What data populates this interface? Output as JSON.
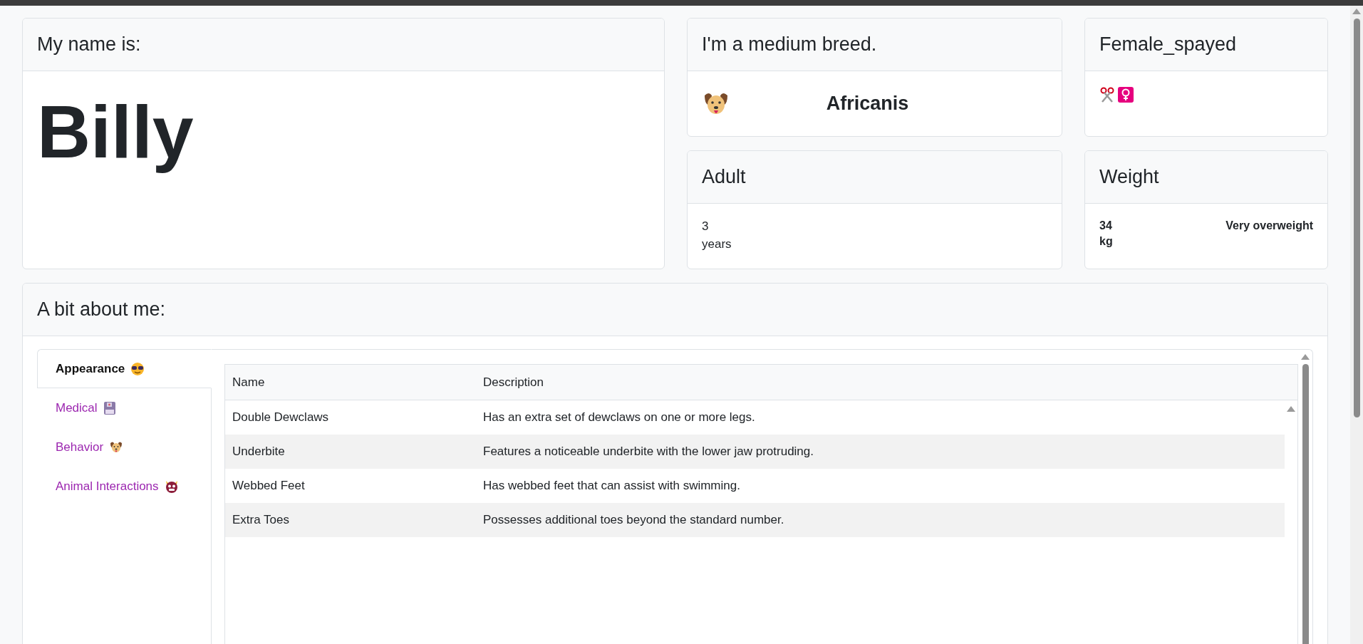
{
  "name_card": {
    "title": "My name is:",
    "name": "Billy"
  },
  "breed_card": {
    "title": "I'm a medium breed.",
    "breed": "Africanis"
  },
  "sex_card": {
    "title": "Female_spayed"
  },
  "age_card": {
    "title": "Adult",
    "value": "3",
    "unit": "years"
  },
  "weight_card": {
    "title": "Weight",
    "value": "34",
    "unit": "kg",
    "status": "Very overweight"
  },
  "about": {
    "title": "A bit about me:",
    "tabs": [
      {
        "label": "Appearance",
        "selected": true
      },
      {
        "label": "Medical",
        "selected": false
      },
      {
        "label": "Behavior",
        "selected": false
      },
      {
        "label": "Animal Interactions",
        "selected": false
      }
    ],
    "table": {
      "columns": [
        "Name",
        "Description"
      ],
      "rows": [
        [
          "Double Dewclaws",
          "Has an extra set of dewclaws on one or more legs."
        ],
        [
          "Underbite",
          "Features a noticeable underbite with the lower jaw protruding."
        ],
        [
          "Webbed Feet",
          "Has webbed feet that can assist with swimming."
        ],
        [
          "Extra Toes",
          "Possesses additional toes beyond the standard number."
        ]
      ]
    }
  }
}
